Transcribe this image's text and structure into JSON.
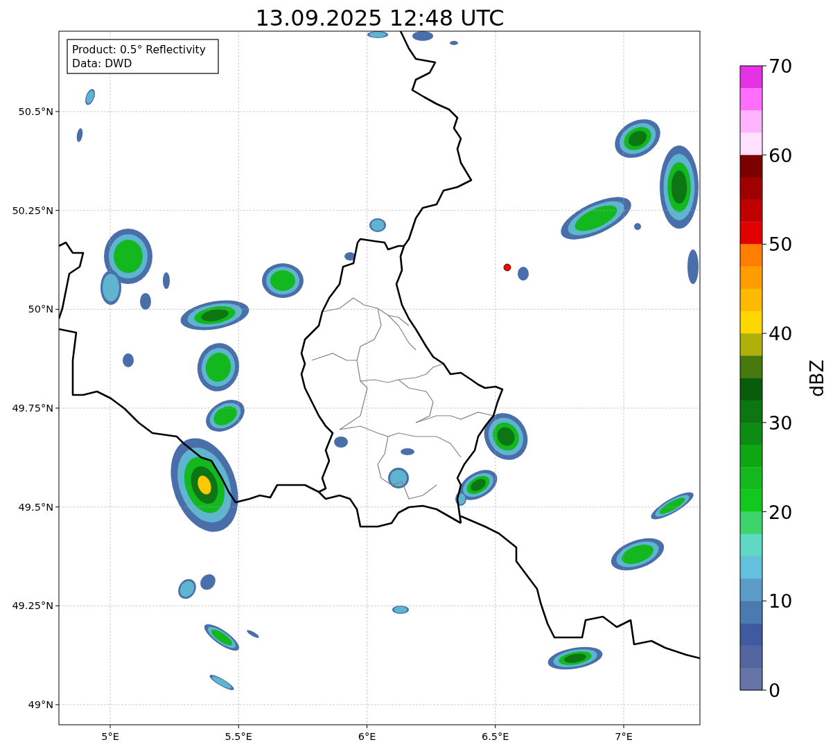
{
  "title": "13.09.2025 12:48 UTC",
  "info_box": [
    "Product: 0.5° Reflectivity",
    "Data: DWD"
  ],
  "map": {
    "lat_labels": [
      "50.5°N",
      "50.25°N",
      "50°N",
      "49.75°N",
      "49.5°N",
      "49.25°N",
      "49°N"
    ],
    "lon_labels": [
      "5°E",
      "5.5°E",
      "6°E",
      "6.5°E",
      "7°E"
    ]
  },
  "colorbar": {
    "label": "dBZ",
    "ticks": [
      "70",
      "60",
      "50",
      "40",
      "30",
      "20",
      "10",
      "0"
    ],
    "bins": [
      {
        "color": "#e632e6"
      },
      {
        "color": "#ff6eff"
      },
      {
        "color": "#ffb4ff"
      },
      {
        "color": "#ffe0ff"
      },
      {
        "color": "#7d0000"
      },
      {
        "color": "#a00000"
      },
      {
        "color": "#c00000"
      },
      {
        "color": "#e10000"
      },
      {
        "color": "#ff7d00"
      },
      {
        "color": "#ff9c00"
      },
      {
        "color": "#ffb900"
      },
      {
        "color": "#ffd700"
      },
      {
        "color": "#b0b00a"
      },
      {
        "color": "#46780e"
      },
      {
        "color": "#085c0c"
      },
      {
        "color": "#0b7612"
      },
      {
        "color": "#0d8c14"
      },
      {
        "color": "#0fa614"
      },
      {
        "color": "#12b81e"
      },
      {
        "color": "#12c81e"
      },
      {
        "color": "#3dd46e"
      },
      {
        "color": "#5fd8c4"
      },
      {
        "color": "#64c1dd"
      },
      {
        "color": "#5a9bc8"
      },
      {
        "color": "#4a7ab0"
      },
      {
        "color": "#405aa0"
      },
      {
        "color": "#52659e"
      },
      {
        "color": "#6673a5"
      }
    ]
  }
}
